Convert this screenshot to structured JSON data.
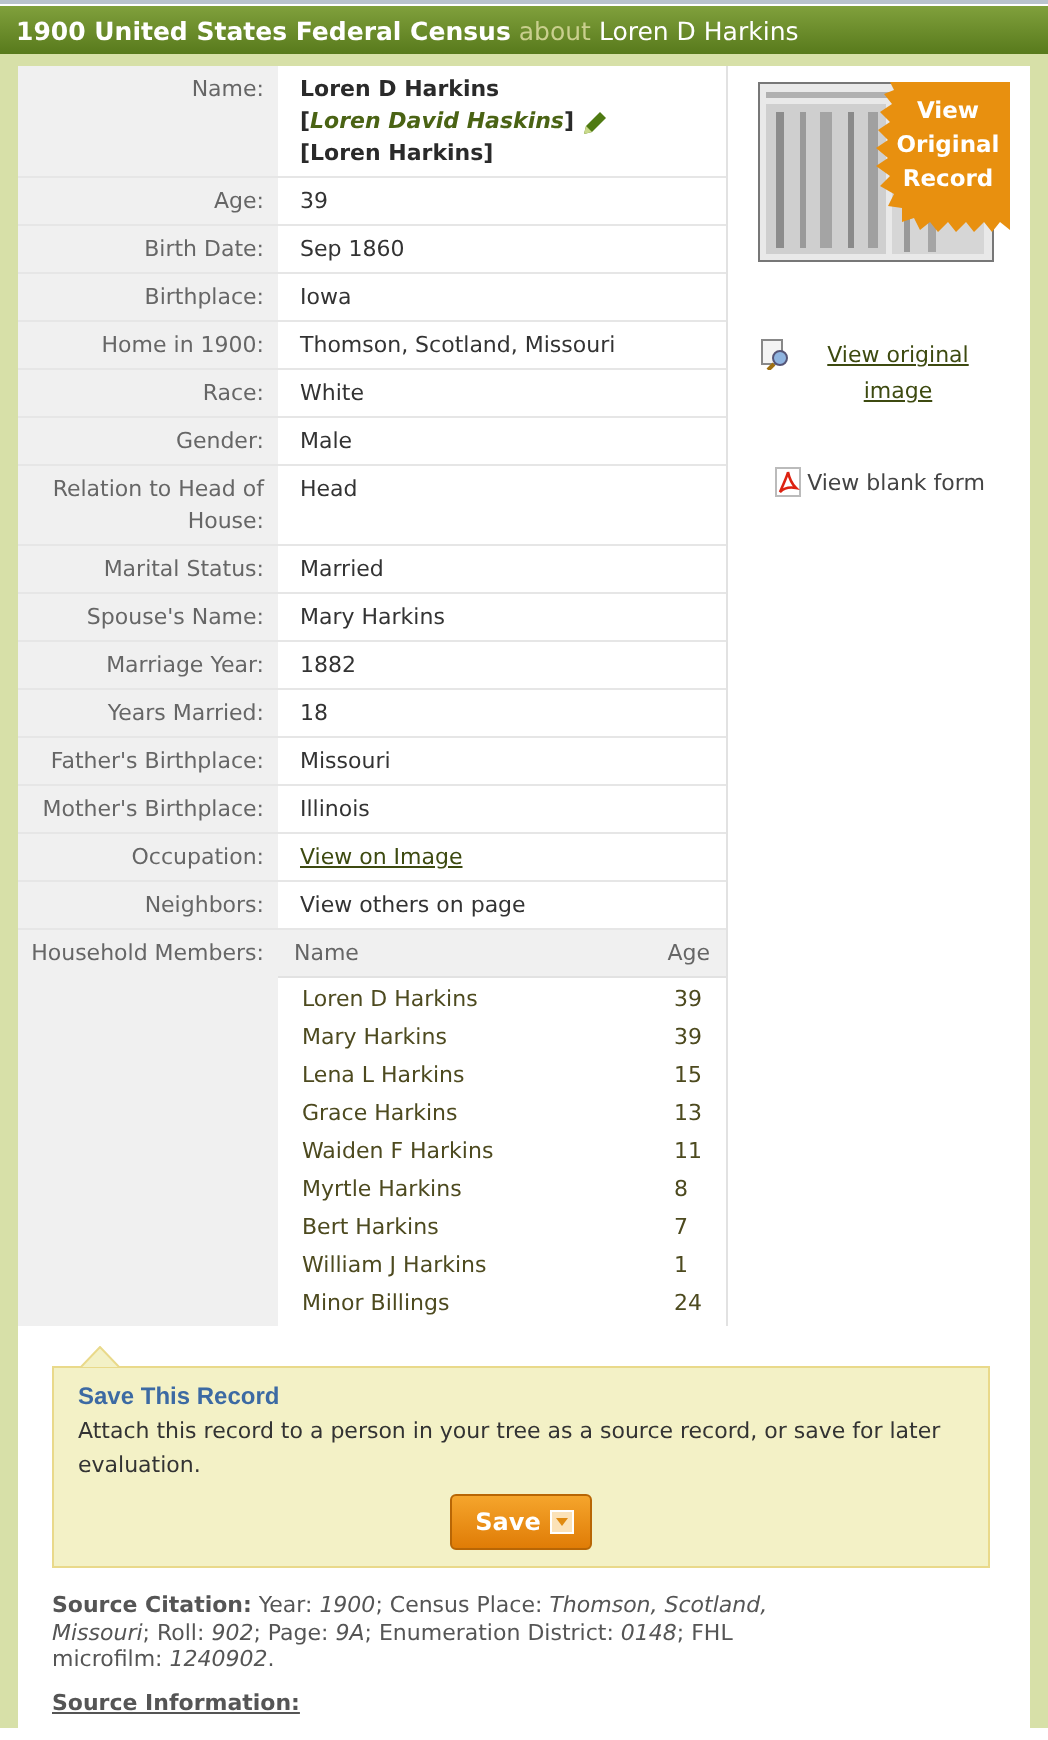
{
  "header": {
    "title": "1900 United States Federal Census",
    "connector": "about",
    "subject": "Loren D Harkins"
  },
  "fields": [
    {
      "label": "Name:",
      "kind": "name",
      "lines": [
        {
          "text": "Loren D Harkins",
          "edited": false
        },
        {
          "text": "[*Loren David Haskins*]",
          "edited": true
        },
        {
          "text": "[Loren Harkins]",
          "edited": false
        }
      ]
    },
    {
      "label": "Age:",
      "kind": "text",
      "value": "39"
    },
    {
      "label": "Birth Date:",
      "kind": "text",
      "value": "Sep 1860"
    },
    {
      "label": "Birthplace:",
      "kind": "text",
      "value": "Iowa"
    },
    {
      "label": "Home in 1900:",
      "kind": "text",
      "value": "Thomson, Scotland, Missouri"
    },
    {
      "label": "Race:",
      "kind": "text",
      "value": "White"
    },
    {
      "label": "Gender:",
      "kind": "text",
      "value": "Male"
    },
    {
      "label": "Relation to Head of House:",
      "kind": "text",
      "value": "Head"
    },
    {
      "label": "Marital Status:",
      "kind": "text",
      "value": "Married"
    },
    {
      "label": "Spouse's Name:",
      "kind": "text",
      "value": "Mary Harkins"
    },
    {
      "label": "Marriage Year:",
      "kind": "text",
      "value": "1882"
    },
    {
      "label": "Years Married:",
      "kind": "text",
      "value": "18"
    },
    {
      "label": "Father's Birthplace:",
      "kind": "text",
      "value": "Missouri"
    },
    {
      "label": "Mother's Birthplace:",
      "kind": "text",
      "value": "Illinois"
    },
    {
      "label": "Occupation:",
      "kind": "link",
      "value": "View on Image"
    },
    {
      "label": "Neighbors:",
      "kind": "text",
      "value": "View others on page"
    },
    {
      "label": "Household Members:",
      "kind": "table",
      "columns": [
        "Name",
        "Age"
      ],
      "rows": [
        [
          "Loren D Harkins",
          "39"
        ],
        [
          "Mary Harkins",
          "39"
        ],
        [
          "Lena L Harkins",
          "15"
        ],
        [
          "Grace Harkins",
          "13"
        ],
        [
          "Waiden F Harkins",
          "11"
        ],
        [
          "Myrtle Harkins",
          "8"
        ],
        [
          "Bert Harkins",
          "7"
        ],
        [
          "William J Harkins",
          "1"
        ],
        [
          "Minor Billings",
          "24"
        ]
      ]
    }
  ],
  "side": {
    "badge": "View Original Record",
    "links": [
      {
        "text": "View original image"
      },
      {
        "text": "View blank form",
        "kind": "pdf"
      }
    ]
  },
  "save": {
    "title": "Save This Record",
    "description": "Attach this record to a person in your tree as a source record, or save for later evaluation.",
    "button": "Save"
  },
  "source": {
    "citation": "**Source Citation:** Year: *1900*; Census Place: *Thomson, Scotland, Missouri*; Roll: *902*; Page: *9A*; Enumeration District: *0148*; FHL microfilm: *1240902*.",
    "info_heading": "Source Information:"
  }
}
